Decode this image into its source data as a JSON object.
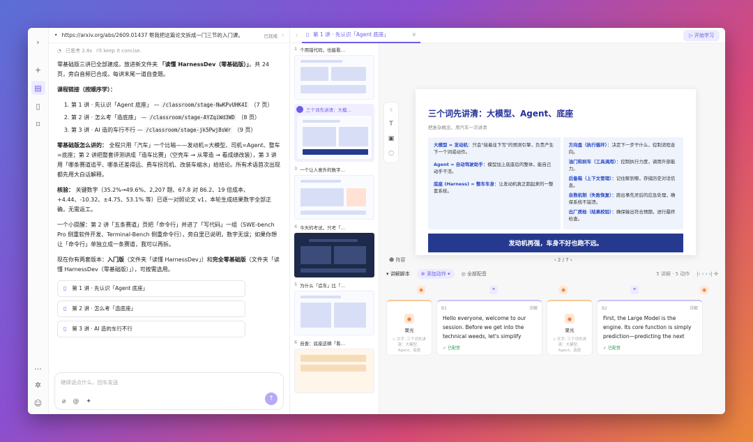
{
  "browser": {
    "url": "https://arxiv.org/abs/2609.01437 帮我把这篇论文拆成一门三节的入门课。",
    "tag": "已就绪"
  },
  "chat": {
    "think": "已思考 2.8s",
    "think_note": "I'll keep it concise.",
    "p1_a": "零基础版三讲已全部建成，放进新文件夹",
    "p1_b": "「读懂 HarnessDev（零基础版）」",
    "p1_c": "。共 24 页，旁白音频已合成，每讲末尾一道自查题。",
    "links_title": "课程链接（按顺序学）：",
    "links": [
      {
        "t": "第 1 讲 · 先认识「Agent 底座」 —",
        "c": "/classroom/stage-NwKPvUHK4I",
        "p": "（7 页）"
      },
      {
        "t": "第 2 讲 · 怎么考「造底座」 —",
        "c": "/classroom/stage-AYZqiWd3WD",
        "p": "（8 页）"
      },
      {
        "t": "第 3 讲 · AI 造的车行不行 —",
        "c": "/classroom/stage-jk5Pwj8sWr",
        "p": "（9 页）"
      }
    ],
    "p2_b": "零基础版怎么讲的：",
    "p2": "全程只用「汽车」一个比喻——发动机=大模型、司机=Agent、整车=底座；第 2 讲把整套评测讲成「造车比赛」（空壳车 → 从零造 → 看成绩改装），第 3 讲用「哪条赛道追平、哪条还差得远、费车拐司机、改装车缩水」给结论。所有术语首次出现都先用大白话解释。",
    "p3_b": "核验：",
    "p3": "关键数字（35.2%→49.6%、2,207 题、67.8 对 86.2、19 倍成本、+4.44、-10.32、±4.75、53.1% 等）已逐一对照论文 v1，本轮生成结果数字全部正确，无需返工。",
    "p4": "一个小提醒：第 2 讲「五条赛道」页把「命令行」并进了「写代码」一组（SWE-bench Pro 侧重软件开发、Terminal-Bench 侧重命令行），旁白里已说明，数字无误；如果你想让「命令行」单独立成一条赛道，我可以再拆。",
    "p5_a": "现在你有两套版本：",
    "p5_b": "入门版",
    "p5_c": "（文件夹「读懂 HarnessDev」）和",
    "p5_d": "完全零基础版",
    "p5_e": "（文件夹「读懂 HarnessDev（零基础版）」），可按需选用。",
    "cards": [
      "第 1 讲 · 先认识「Agent 底座」",
      "第 2 讲 · 怎么考「造底座」",
      "第 3 讲 · AI 造的车行不行"
    ],
    "placeholder": "继续说点什么，回车发送"
  },
  "tab": {
    "title": "第 1 讲 · 先认识「Agent 底座」",
    "learn": "开始学习"
  },
  "thumbs": [
    {
      "n": "1",
      "t": "个用错代码，也能看…"
    },
    {
      "n": "2",
      "t": "三个词先讲清：大模…"
    },
    {
      "n": "3",
      "t": "一个让人意外的数字…"
    },
    {
      "n": "4",
      "t": "今天的考试，只考「…"
    },
    {
      "n": "5",
      "t": "为什么「造车」比「…"
    },
    {
      "n": "6",
      "t": "自查：底座这辆「看…"
    }
  ],
  "slide": {
    "title": "三个词先讲清：大模型、Agent、底座",
    "sub": "把复杂概念，用汽车一次讲清",
    "left": [
      {
        "k": "大模型 = 发动机",
        "v": "：只会\"接着往下写\"的预测引擎，负责产生下一个词或动作。"
      },
      {
        "k": "Agent = 自动驾驶助手",
        "v": "：模型加上底座后的整体，能自己动手干活。"
      },
      {
        "k": "底座 (Harness) = 整车车身",
        "v": "：让发动机真正跑起来的一整套系统。"
      }
    ],
    "right": [
      {
        "k": "方向盘（执行循环）",
        "v": "：决定下一步干什么，控制流程走向。"
      },
      {
        "k": "油门和刹车（工具调用）",
        "v": "：控制执行力度，调用外部能力。"
      },
      {
        "k": "后备箱（上下文管理）",
        "v": "：记住聊到哪，存储历史对话信息。"
      },
      {
        "k": "自救机制（失败恢复）",
        "v": "：跑出事先灵后的应急处理，确保系统不崩溃。"
      },
      {
        "k": "出厂质检（结果校验）",
        "v": "：确保输出符合预期，进行最终检查。"
      }
    ],
    "banner": "发动机再强，车身不好也跑不远。"
  },
  "pager": {
    "left": "阵容",
    "page": "2 / 7"
  },
  "script": {
    "label": "讲解脚本",
    "add": "添加动作",
    "all": "全部配音",
    "stats": "5 讲解 · 5 动作"
  },
  "timeline": {
    "vis_label": "聚光",
    "vis_sub": "◇ 文字: 三个词先讲清：大模型、Agent、底座",
    "t1_hd": "B1",
    "t2_hd": "B2",
    "edit": "详解",
    "t1": "Hello everyone, welcome to our session. Before we get into the technical weeds, let's simplify",
    "t2": "First, the Large Model is the engine. Its core function is simply prediction—predicting the next",
    "done": "已配音"
  },
  "colors": {
    "accent": "#6b5ce7",
    "slide_title": "#25309a",
    "banner": "#253a8f"
  }
}
